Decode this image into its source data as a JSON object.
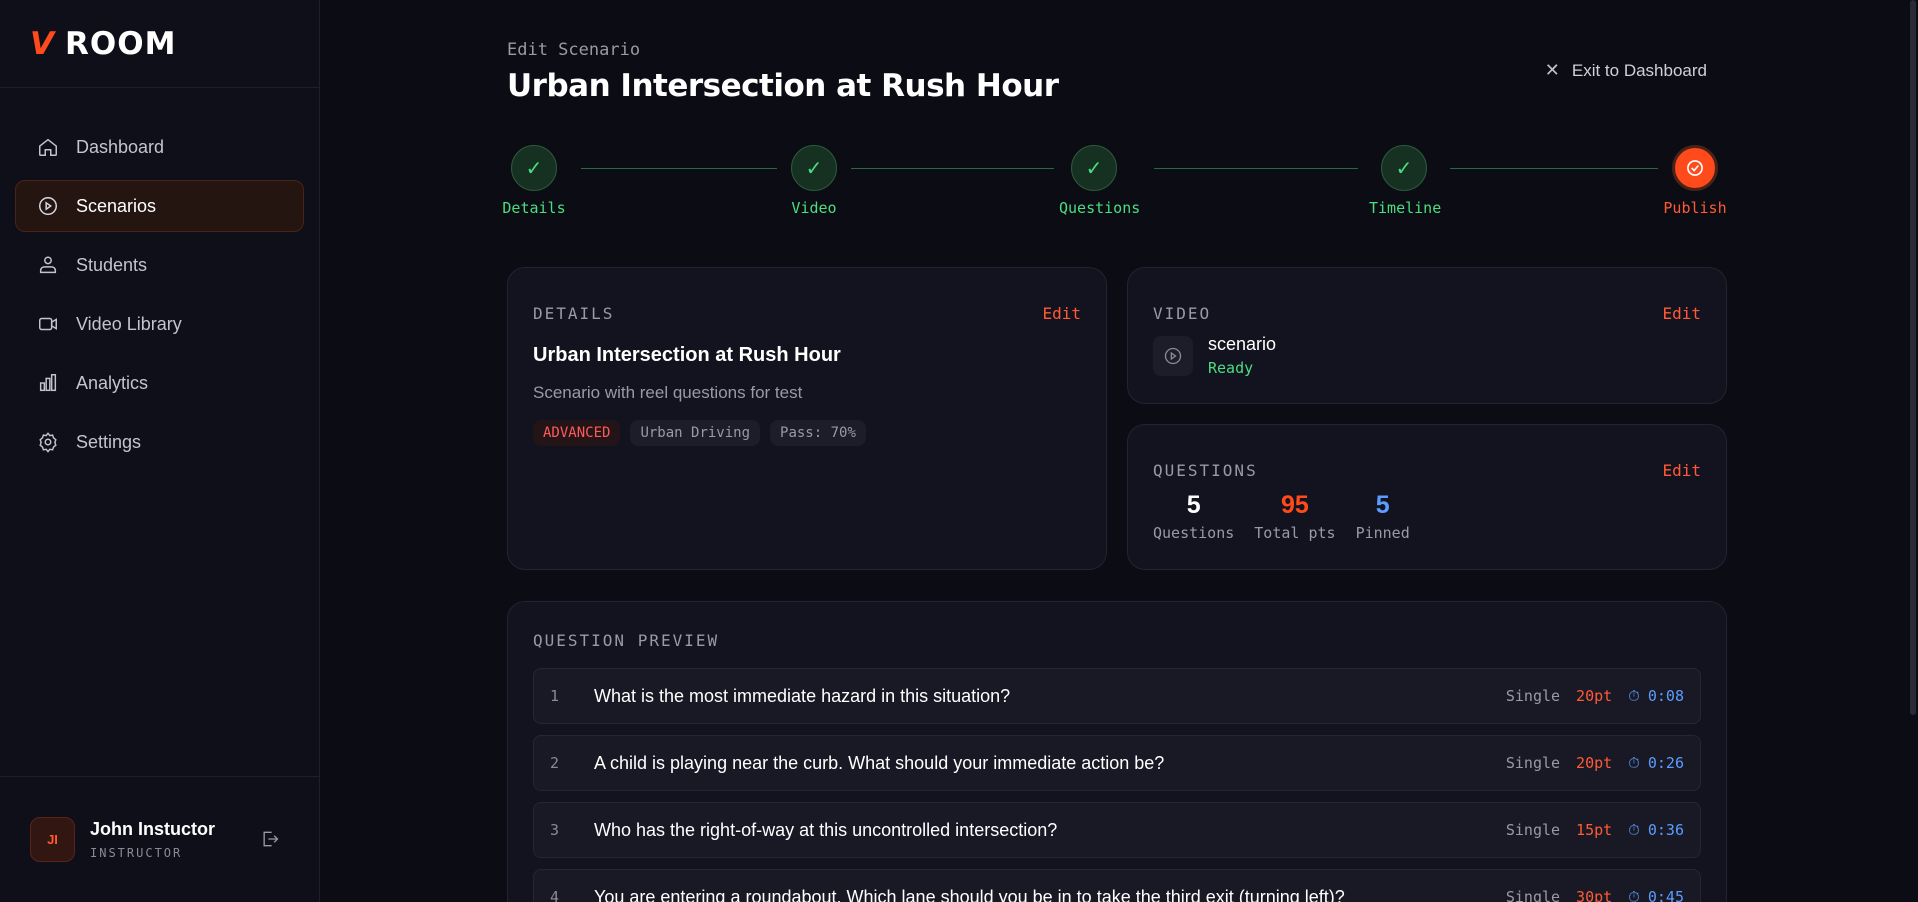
{
  "brand": {
    "v": "V",
    "rest": "ROOM"
  },
  "sidebar": {
    "items": [
      {
        "label": "Dashboard",
        "icon": "home-icon"
      },
      {
        "label": "Scenarios",
        "icon": "play-circle-icon",
        "active": true
      },
      {
        "label": "Students",
        "icon": "users-icon"
      },
      {
        "label": "Video Library",
        "icon": "video-icon"
      },
      {
        "label": "Analytics",
        "icon": "bar-chart-icon"
      },
      {
        "label": "Settings",
        "icon": "gear-icon"
      }
    ]
  },
  "user": {
    "initials": "JI",
    "name": "John Instuctor",
    "role": "INSTRUCTOR"
  },
  "header": {
    "crumb": "Edit Scenario",
    "title": "Urban Intersection at Rush Hour",
    "exit_label": "Exit to Dashboard"
  },
  "steps": [
    {
      "label": "Details",
      "status": "done"
    },
    {
      "label": "Video",
      "status": "done"
    },
    {
      "label": "Questions",
      "status": "done"
    },
    {
      "label": "Timeline",
      "status": "done"
    },
    {
      "label": "Publish",
      "status": "current"
    }
  ],
  "details": {
    "heading": "DETAILS",
    "edit": "Edit",
    "title": "Urban Intersection at Rush Hour",
    "description": "Scenario with reel questions for test",
    "tags": [
      "ADVANCED",
      "Urban Driving",
      "Pass: 70%"
    ]
  },
  "video": {
    "heading": "VIDEO",
    "edit": "Edit",
    "name": "scenario",
    "status": "Ready"
  },
  "questions": {
    "heading": "QUESTIONS",
    "edit": "Edit",
    "stats": [
      {
        "value": "5",
        "label": "Questions"
      },
      {
        "value": "95",
        "label": "Total pts"
      },
      {
        "value": "5",
        "label": "Pinned"
      }
    ]
  },
  "preview": {
    "heading": "QUESTION PREVIEW",
    "rows": [
      {
        "num": "1",
        "text": "What is the most immediate hazard in this situation?",
        "type": "Single",
        "pts": "20pt",
        "time": "0:08"
      },
      {
        "num": "2",
        "text": "A child is playing near the curb. What should your immediate action be?",
        "type": "Single",
        "pts": "20pt",
        "time": "0:26"
      },
      {
        "num": "3",
        "text": "Who has the right-of-way at this uncontrolled intersection?",
        "type": "Single",
        "pts": "15pt",
        "time": "0:36"
      },
      {
        "num": "4",
        "text": "You are entering a roundabout. Which lane should you be in to take the third exit (turning left)?",
        "type": "Single",
        "pts": "30pt",
        "time": "0:45"
      }
    ]
  },
  "colors": {
    "accent": "#ff4a1c",
    "success": "#4ade80",
    "info": "#5a9dff"
  }
}
